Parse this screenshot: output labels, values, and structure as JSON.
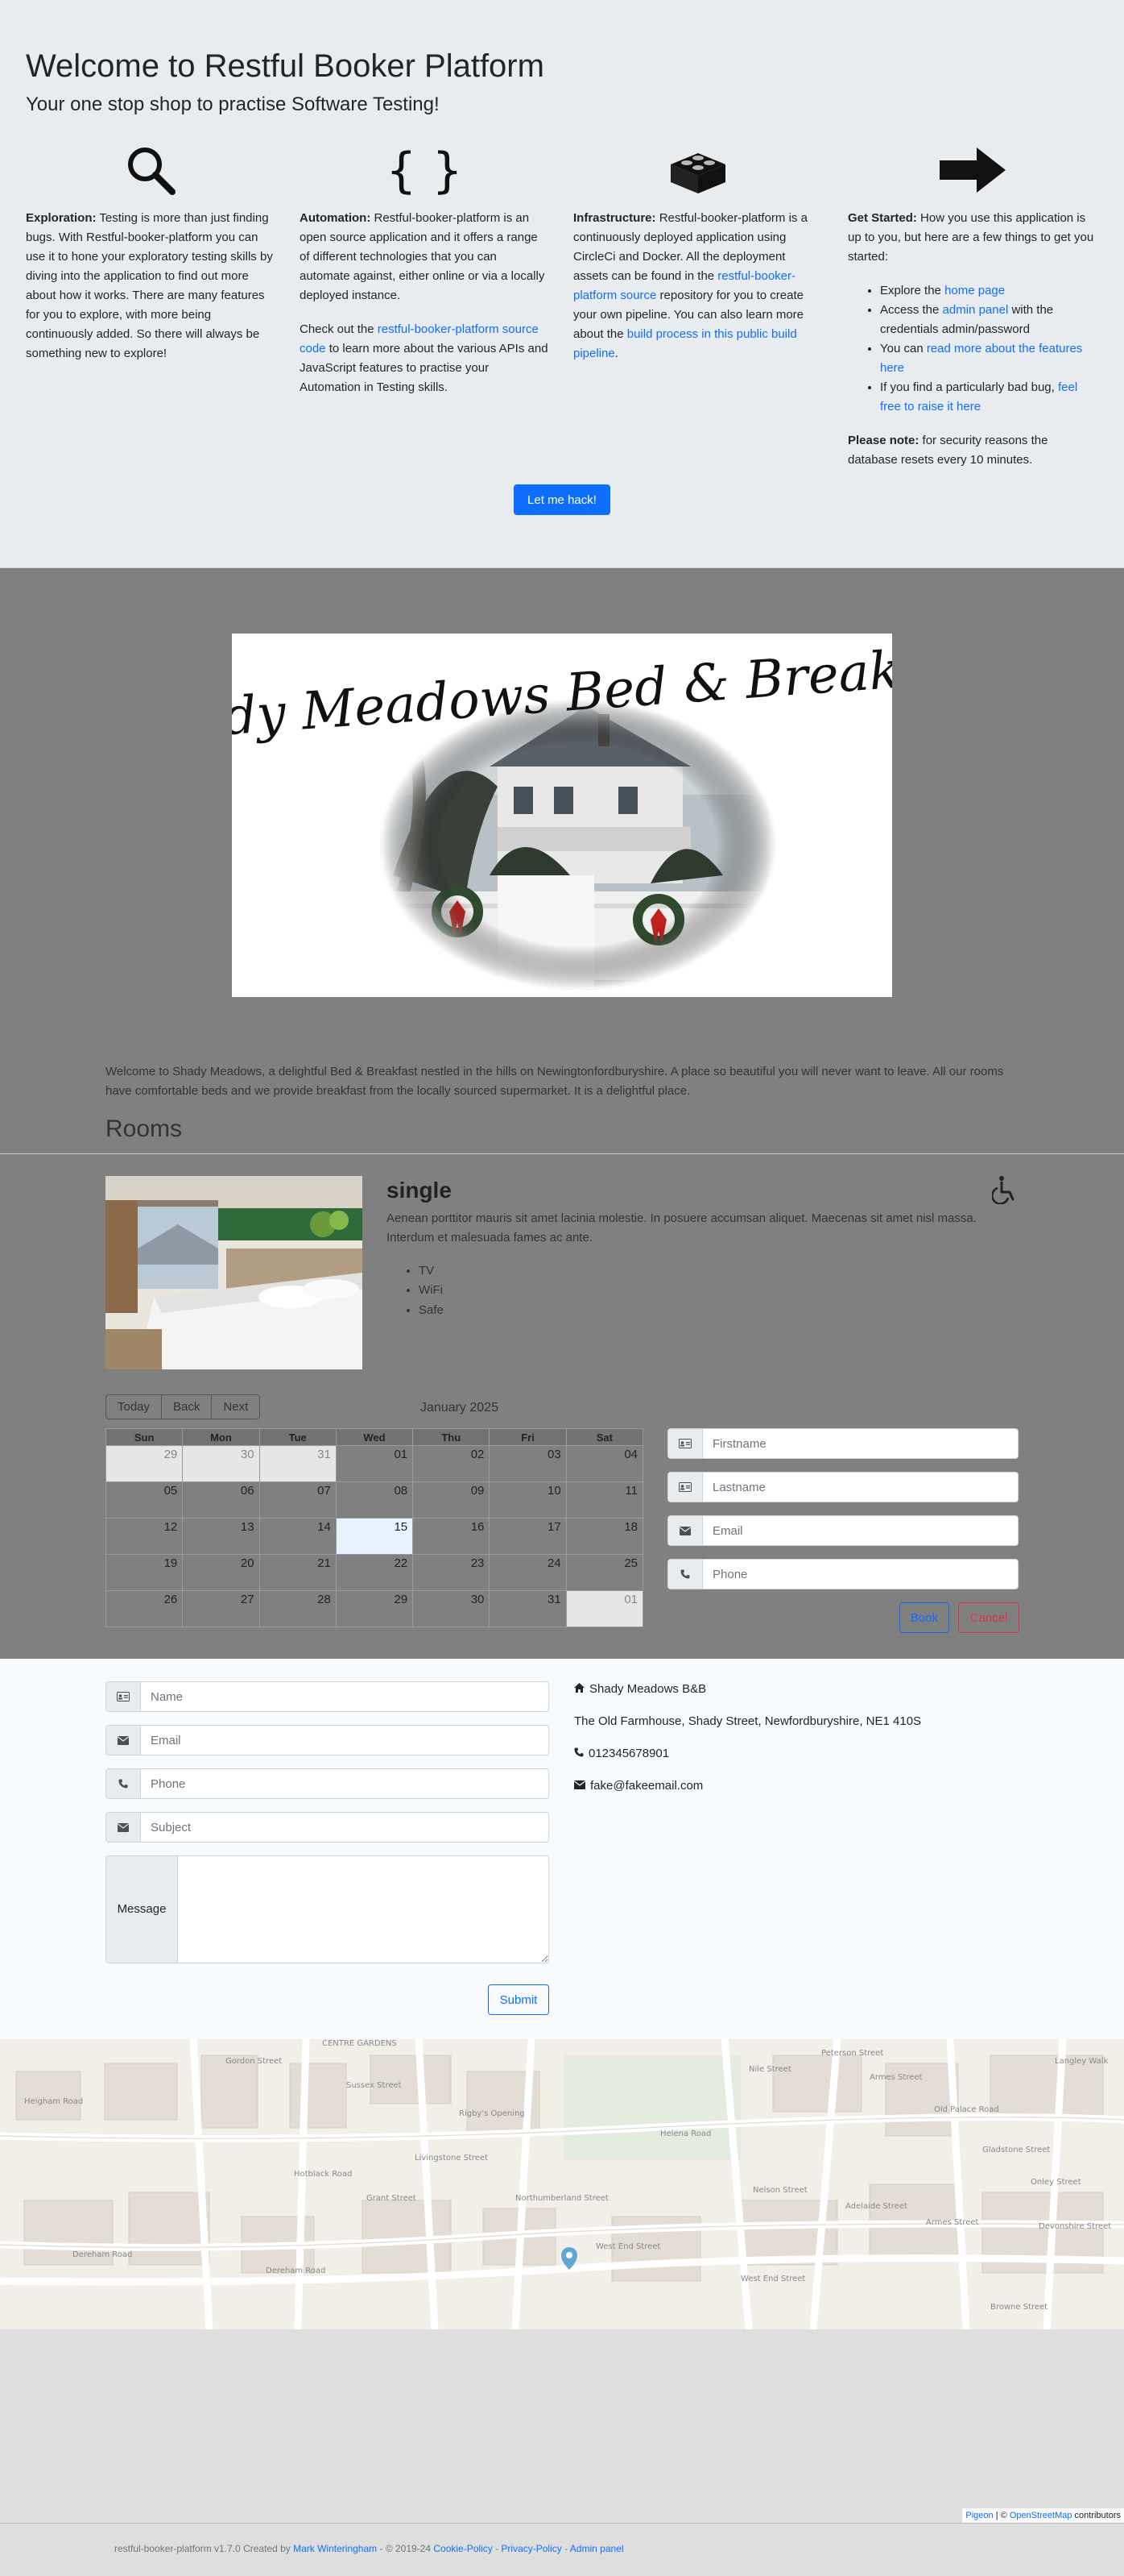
{
  "hero": {
    "title": "Welcome to Restful Booker Platform",
    "subtitle": "Your one stop shop to practise Software Testing!",
    "exploration": {
      "heading": "Exploration:",
      "text": "Testing is more than just finding bugs. With Restful-booker-platform you can use it to hone your exploratory testing skills by diving into the application to find out more about how it works. There are many features for you to explore, with more being continuously added. So there will always be something new to explore!"
    },
    "automation": {
      "heading": "Automation:",
      "text": "Restful-booker-platform is an open source application and it offers a range of different technologies that you can automate against, either online or via a locally deployed instance.",
      "p2_before": "Check out the",
      "p2_link": "restful-booker-platform source code",
      "p2_after": "to learn more about the various APIs and JavaScript features to practise your Automation in Testing skills."
    },
    "infrastructure": {
      "heading": "Infrastructure:",
      "text": "Restful-booker-platform is a continuously deployed application using CircleCi and Docker. All the deployment assets can be found in the",
      "link1": "restful-booker-platform source",
      "text2": "repository for you to create your own pipeline. You can also learn more about the",
      "link2": "build process in this public build pipeline",
      "text3": "."
    },
    "get_started": {
      "heading": "Get Started:",
      "text": "How you use this application is up to you, but here are a few things to get you started:",
      "item1_before": "Explore the",
      "item1_link": "home page",
      "item2_before": "Access the",
      "item2_link": "admin panel",
      "item2_after": "with the credentials admin/password",
      "item3_before": "You can",
      "item3_link": "read more about the features here",
      "item4_before": "If you find a particularly bad bug,",
      "item4_link": "feel free to raise it here",
      "note_heading": "Please note:",
      "note_text": "for security reasons the database resets every 10 minutes."
    },
    "hack_button": "Let me hack!"
  },
  "hotel": {
    "logo_text": "Shady Meadows Bed & Breakfast",
    "welcome": "Welcome to Shady Meadows, a delightful Bed & Breakfast nestled in the hills on Newingtonfordburyshire. A place so beautiful you will never want to leave. All our rooms have comfortable beds and we provide breakfast from the locally sourced supermarket. It is a delightful place."
  },
  "rooms": {
    "title": "Rooms",
    "room": {
      "name": "single",
      "description": "Aenean porttitor mauris sit amet lacinia molestie. In posuere accumsan aliquet. Maecenas sit amet nisl massa. Interdum et malesuada fames ac ante.",
      "features": [
        "TV",
        "WiFi",
        "Safe"
      ],
      "accessible_icon": "wheelchair-icon"
    }
  },
  "calendar": {
    "buttons": {
      "today": "Today",
      "back": "Back",
      "next": "Next"
    },
    "title": "January 2025",
    "weekdays": [
      "Sun",
      "Mon",
      "Tue",
      "Wed",
      "Thu",
      "Fri",
      "Sat"
    ],
    "weeks": [
      [
        "29",
        "30",
        "31",
        "01",
        "02",
        "03",
        "04"
      ],
      [
        "05",
        "06",
        "07",
        "08",
        "09",
        "10",
        "11"
      ],
      [
        "12",
        "13",
        "14",
        "15",
        "16",
        "17",
        "18"
      ],
      [
        "19",
        "20",
        "21",
        "22",
        "23",
        "24",
        "25"
      ],
      [
        "26",
        "27",
        "28",
        "29",
        "30",
        "31",
        "01"
      ]
    ],
    "off_range": [
      [
        0,
        0
      ],
      [
        0,
        1
      ],
      [
        0,
        2
      ],
      [
        4,
        6
      ]
    ],
    "today": [
      2,
      3
    ]
  },
  "booking": {
    "firstname_placeholder": "Firstname",
    "lastname_placeholder": "Lastname",
    "email_placeholder": "Email",
    "phone_placeholder": "Phone",
    "book_button": "Book",
    "cancel_button": "Cancel"
  },
  "contact": {
    "name_placeholder": "Name",
    "email_placeholder": "Email",
    "phone_placeholder": "Phone",
    "subject_placeholder": "Subject",
    "message_label": "Message",
    "submit_button": "Submit",
    "business_name": "Shady Meadows B&B",
    "address": "The Old Farmhouse, Shady Street, Newfordburyshire, NE1 410S",
    "phone": "012345678901",
    "email": "fake@fakeemail.com"
  },
  "map": {
    "streets": [
      "CENTRE GARDENS",
      "Dereham Road",
      "Dereham Road",
      "West End Street",
      "West End Street",
      "Adelaide Street",
      "Armes Street",
      "Nelson Street",
      "Old Palace Road",
      "Devonshire Street",
      "Browne Street",
      "Gladstone Street",
      "Onley Street",
      "Heigham Road",
      "Sussex Street",
      "Helena Road",
      "Rigby's Opening",
      "Northumberland Street",
      "Livingstone Street",
      "Hotblack Road",
      "Grant Street",
      "Langley Walk",
      "Nile Street",
      "Armes Street",
      "Peterson Street",
      "Gordon Street"
    ],
    "attribution_pigeon": "Pigeon",
    "attribution_sep": " | © ",
    "attribution_osm": "OpenStreetMap",
    "attribution_tail": " contributors"
  },
  "footer": {
    "text_before": "restful-booker-platform v1.7.0 Created by",
    "author": "Mark Winteringham",
    "years": "- © 2019-24",
    "cookie": "Cookie-Policy",
    "privacy": "Privacy-Policy",
    "admin": "Admin panel",
    "dash": "-"
  }
}
